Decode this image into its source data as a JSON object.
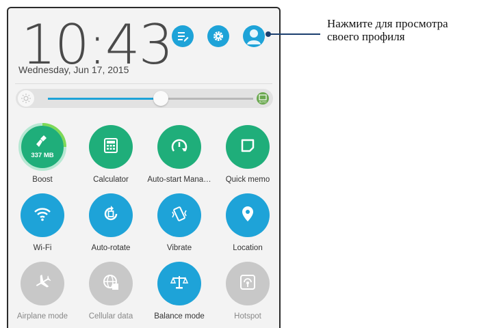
{
  "clock": {
    "time": "10:43",
    "date": "Wednesday, Jun 17, 2015"
  },
  "top_buttons": [
    {
      "name": "edit-tiles",
      "icon": "edit-list-icon"
    },
    {
      "name": "settings",
      "icon": "gear-icon"
    },
    {
      "name": "profile",
      "icon": "user-avatar-icon"
    }
  ],
  "brightness": {
    "level": 0.55,
    "auto_label": "AUTO"
  },
  "tiles": [
    {
      "label": "Boost",
      "icon": "broom-icon",
      "value": "337 MB",
      "state": "on",
      "color": "#1fae7a"
    },
    {
      "label": "Calculator",
      "icon": "calculator-icon",
      "state": "on",
      "color": "#1fae7a"
    },
    {
      "label": "Auto-start Mana…",
      "icon": "autostart-gauge-icon",
      "state": "on",
      "color": "#1fae7a"
    },
    {
      "label": "Quick memo",
      "icon": "memo-icon",
      "state": "on",
      "color": "#1fae7a"
    },
    {
      "label": "Wi-Fi",
      "icon": "wifi-icon",
      "state": "on",
      "color": "#1ea3d8"
    },
    {
      "label": "Auto-rotate",
      "icon": "rotate-icon",
      "state": "on",
      "color": "#1ea3d8"
    },
    {
      "label": "Vibrate",
      "icon": "vibrate-icon",
      "state": "on",
      "color": "#1ea3d8"
    },
    {
      "label": "Location",
      "icon": "location-pin-icon",
      "state": "on",
      "color": "#1ea3d8"
    },
    {
      "label": "Airplane mode",
      "icon": "airplane-icon",
      "state": "off",
      "color": "#c8c8c8"
    },
    {
      "label": "Cellular data",
      "icon": "globe-icon",
      "state": "off",
      "color": "#c8c8c8"
    },
    {
      "label": "Balance mode",
      "icon": "balance-scale-icon",
      "state": "on",
      "color": "#1ea3d8"
    },
    {
      "label": "Hotspot",
      "icon": "hotspot-icon",
      "state": "off",
      "color": "#c8c8c8"
    }
  ],
  "annotation": {
    "text": "Нажмите для просмотра своего профиля"
  },
  "colors": {
    "accent": "#1ea3d8",
    "green": "#1fae7a",
    "disabled": "#c8c8c8"
  }
}
